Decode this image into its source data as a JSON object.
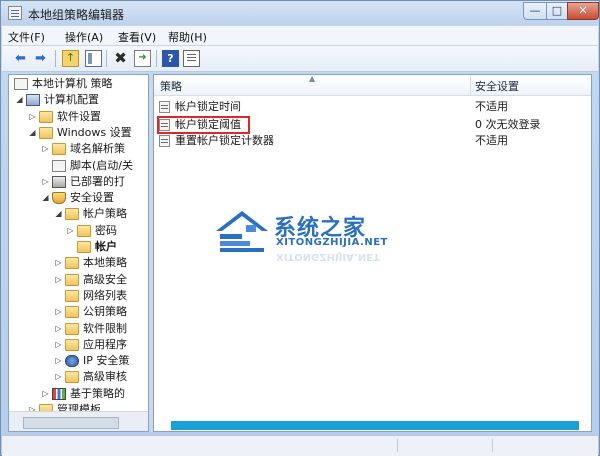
{
  "window": {
    "title": "本地组策略编辑器",
    "minimize": "—",
    "maximize": "□",
    "close": "✕"
  },
  "menu": [
    "文件(F)",
    "操作(A)",
    "查看(V)",
    "帮助(H)"
  ],
  "toolbar": {
    "back": "⬅",
    "forward": "➡",
    "up": "↑",
    "delete": "✖",
    "export": "➜",
    "help": "?",
    "icons": [
      "back-arrow-icon",
      "forward-arrow-icon",
      "up-folder-icon",
      "show-hide-tree-icon",
      "delete-icon",
      "export-list-icon",
      "help-icon",
      "properties-icon"
    ]
  },
  "tree": [
    {
      "label": "本地计算机 策略",
      "expander": "",
      "icon": "doc"
    },
    {
      "label": "计算机配置",
      "expander": "◢",
      "icon": "computer"
    },
    {
      "label": "软件设置",
      "expander": "▷",
      "icon": "folder"
    },
    {
      "label": "Windows 设置",
      "expander": "◢",
      "icon": "folder"
    },
    {
      "label": "域名解析策",
      "expander": "▷",
      "icon": "folder"
    },
    {
      "label": "脚本(启动/关",
      "expander": "",
      "icon": "doc"
    },
    {
      "label": "已部署的打",
      "expander": "▷",
      "icon": "printer"
    },
    {
      "label": "安全设置",
      "expander": "◢",
      "icon": "shield"
    },
    {
      "label": "帐户策略",
      "expander": "◢",
      "icon": "folder"
    },
    {
      "label": "密码",
      "expander": "▷",
      "icon": "folder"
    },
    {
      "label": "帐户",
      "expander": "",
      "icon": "folder"
    },
    {
      "label": "本地策略",
      "expander": "▷",
      "icon": "folder"
    },
    {
      "label": "高级安全",
      "expander": "▷",
      "icon": "folder"
    },
    {
      "label": "网络列表",
      "expander": "",
      "icon": "folder"
    },
    {
      "label": "公钥策略",
      "expander": "▷",
      "icon": "folder"
    },
    {
      "label": "软件限制",
      "expander": "▷",
      "icon": "folder"
    },
    {
      "label": "应用程序",
      "expander": "▷",
      "icon": "folder"
    },
    {
      "label": "IP 安全策",
      "expander": "▷",
      "icon": "ipsec"
    },
    {
      "label": "高级审核",
      "expander": "▷",
      "icon": "folder"
    },
    {
      "label": "基于策略的",
      "expander": "▷",
      "icon": "bars"
    },
    {
      "label": "管理模板",
      "expander": "▷",
      "icon": "folder"
    }
  ],
  "list": {
    "columns": {
      "policy": "策略",
      "setting": "安全设置",
      "sort": "▲"
    },
    "rows": [
      {
        "name": "帐户锁定时间",
        "value": "不适用"
      },
      {
        "name": "帐户锁定阈值",
        "value": "0 次无效登录"
      },
      {
        "name": "重置帐户锁定计数器",
        "value": "不适用"
      }
    ]
  },
  "watermark": {
    "name": "系统之家",
    "url": "XITONGZHIJIA.NET"
  },
  "colors": {
    "accent": "#1aa0d8",
    "highlight": "#e0262b",
    "logo": "#2b6fc2"
  }
}
